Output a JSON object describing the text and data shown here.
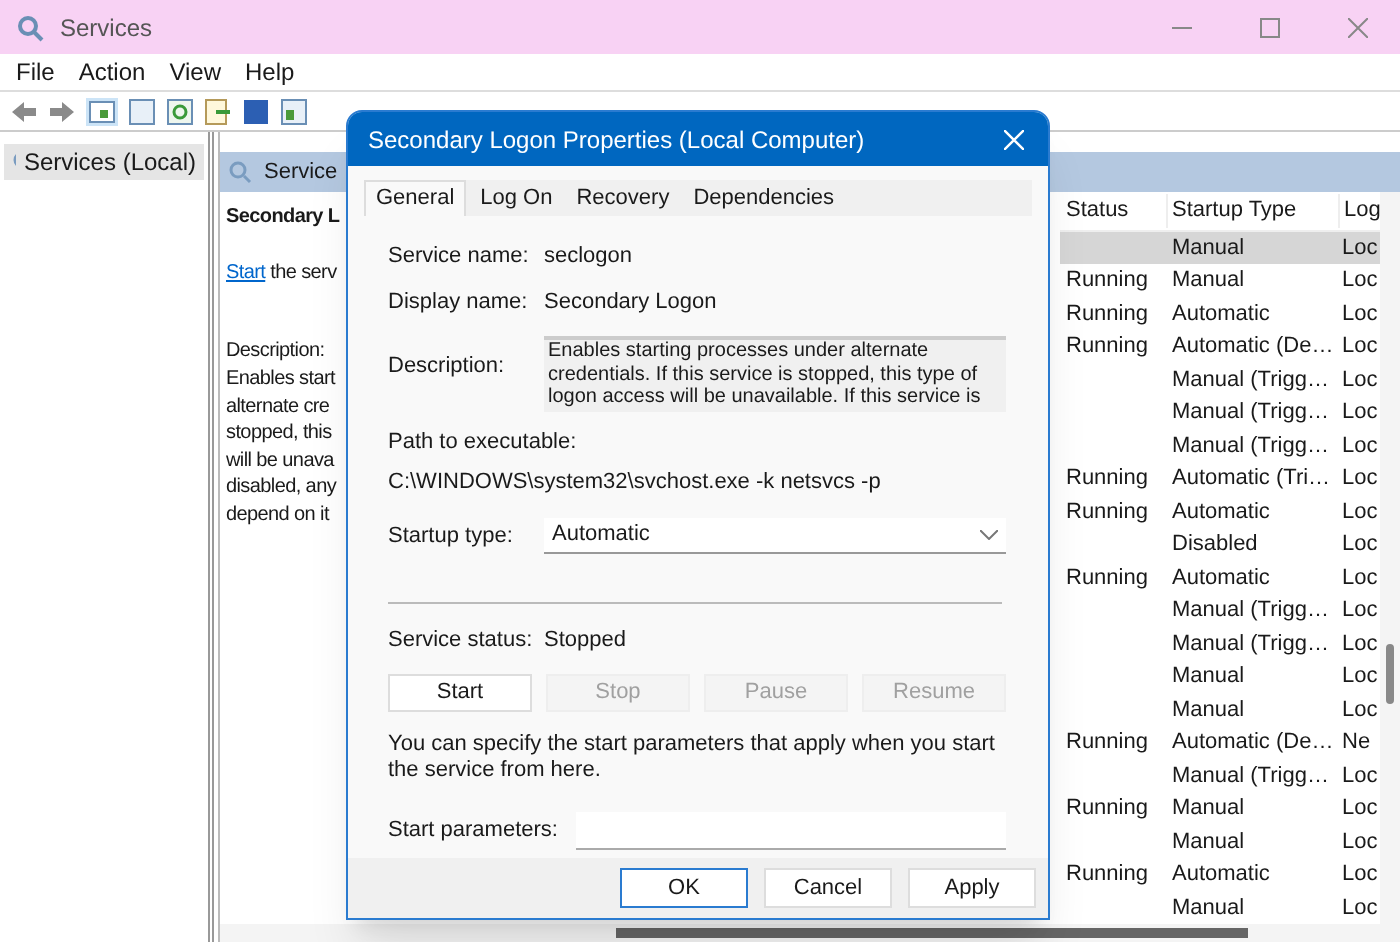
{
  "window": {
    "title": "Services"
  },
  "menu": [
    "File",
    "Action",
    "View",
    "Help"
  ],
  "tree": [
    {
      "label": "Services (Local)",
      "selected": true
    }
  ],
  "detail": {
    "header": "Service",
    "title": "Secondary L",
    "start_link": "Start",
    "start_rest": "the serv",
    "description_label": "Description:",
    "description_lines": [
      "Enables start",
      "alternate cre",
      "stopped, this",
      "will be unava",
      "disabled, any",
      "depend on it"
    ]
  },
  "table": {
    "columns": [
      "Status",
      "Startup Type",
      "Log"
    ],
    "rows": [
      {
        "startup_type": "Manual",
        "log_on_as": "Loc",
        "selected": true
      },
      {
        "status": "Running",
        "startup_type": "Manual",
        "log_on_as": "Loc",
        "selected": false
      },
      {
        "status": "Running",
        "startup_type": "Automatic",
        "log_on_as": "Loc",
        "selected": false
      },
      {
        "status": "Running",
        "startup_type": "Automatic (De…",
        "log_on_as": "Loc",
        "selected": false
      },
      {
        "startup_type": "Manual (Trigg…",
        "log_on_as": "Loc",
        "selected": false
      },
      {
        "startup_type": "Manual (Trigg…",
        "log_on_as": "Loc",
        "selected": false
      },
      {
        "startup_type": "Manual (Trigg…",
        "log_on_as": "Loc",
        "selected": false
      },
      {
        "status": "Running",
        "startup_type": "Automatic (Tri…",
        "log_on_as": "Loc",
        "selected": false
      },
      {
        "status": "Running",
        "startup_type": "Automatic",
        "log_on_as": "Loc",
        "selected": false
      },
      {
        "startup_type": "Disabled",
        "log_on_as": "Loc",
        "selected": false
      },
      {
        "status": "Running",
        "startup_type": "Automatic",
        "log_on_as": "Loc",
        "selected": false
      },
      {
        "startup_type": "Manual (Trigg…",
        "log_on_as": "Loc",
        "selected": false
      },
      {
        "startup_type": "Manual (Trigg…",
        "log_on_as": "Loc",
        "selected": false
      },
      {
        "startup_type": "Manual",
        "log_on_as": "Loc",
        "selected": false
      },
      {
        "startup_type": "Manual",
        "log_on_as": "Loc",
        "selected": false
      },
      {
        "status": "Running",
        "startup_type": "Automatic (De…",
        "log_on_as": "Ne",
        "selected": false
      },
      {
        "startup_type": "Manual (Trigg…",
        "log_on_as": "Loc",
        "selected": false
      },
      {
        "status": "Running",
        "startup_type": "Manual",
        "log_on_as": "Loc",
        "selected": false
      },
      {
        "startup_type": "Manual",
        "log_on_as": "Loc",
        "selected": false
      },
      {
        "status": "Running",
        "startup_type": "Automatic",
        "log_on_as": "Loc",
        "selected": false
      },
      {
        "startup_type": "Manual",
        "log_on_as": "Loc",
        "selected": false
      }
    ]
  },
  "dialog": {
    "title": "Secondary Logon Properties (Local Computer)",
    "tabs": [
      {
        "label": "General",
        "selected": true
      },
      {
        "label": "Log On",
        "selected": false
      },
      {
        "label": "Recovery",
        "selected": false
      },
      {
        "label": "Dependencies",
        "selected": false
      }
    ],
    "service_name": {
      "label": "Service name:",
      "value": "seclogon"
    },
    "display_name": {
      "label": "Display name:",
      "value": "Secondary Logon"
    },
    "description": {
      "label": "Description:",
      "value": "Enables starting processes under alternate credentials. If this service is stopped, this type of logon access will be unavailable. If this service is"
    },
    "path": {
      "label": "Path to executable:",
      "value": "C:\\WINDOWS\\system32\\svchost.exe -k netsvcs -p"
    },
    "startup_type": {
      "label": "Startup type:",
      "value": "Automatic"
    },
    "service_status": {
      "label": "Service status:",
      "value": "Stopped"
    },
    "control_buttons": [
      {
        "label": "Start",
        "disabled": false
      },
      {
        "label": "Stop",
        "disabled": true
      },
      {
        "label": "Pause",
        "disabled": true
      },
      {
        "label": "Resume",
        "disabled": true
      }
    ],
    "hint": "You can specify the start parameters that apply when you start the service from here.",
    "start_parameters": {
      "label": "Start parameters:"
    },
    "buttons": [
      "OK",
      "Cancel",
      "Apply"
    ]
  }
}
